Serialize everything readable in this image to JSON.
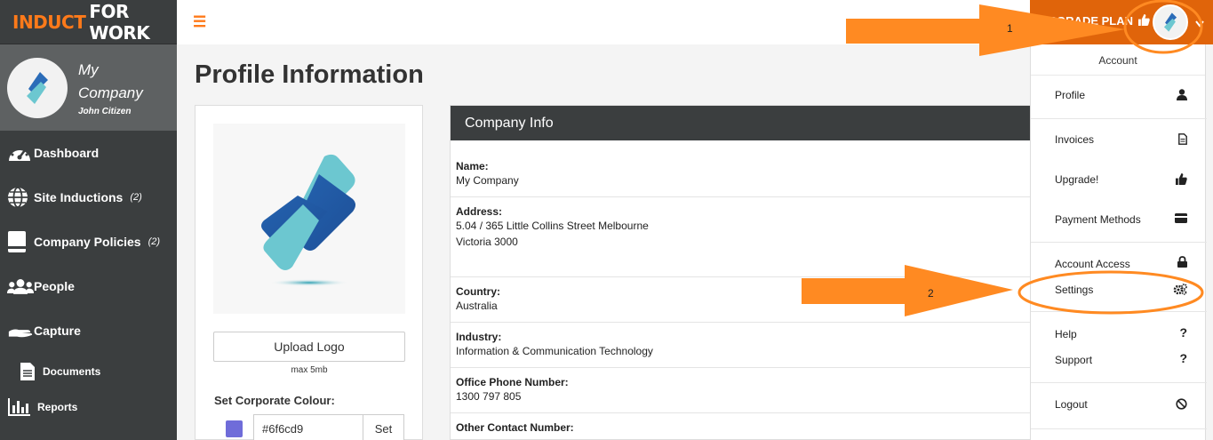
{
  "brand": {
    "part1": "INDUCT",
    "part2": "FOR WORK"
  },
  "company": {
    "name_line1": "My",
    "name_line2": "Company",
    "user": "John Citizen"
  },
  "nav": [
    {
      "label": "Dashboard",
      "icon": "dashboard-gauge-icon",
      "count": ""
    },
    {
      "label": "Site Inductions",
      "icon": "globe-icon",
      "count": "(2)"
    },
    {
      "label": "Company Policies",
      "icon": "book-icon",
      "count": "(2)"
    },
    {
      "label": "People",
      "icon": "people-icon",
      "count": ""
    },
    {
      "label": "Capture",
      "icon": "hand-icon",
      "count": ""
    }
  ],
  "nav_sub": [
    {
      "label": "Documents",
      "icon": "document-icon"
    },
    {
      "label": "Reports",
      "icon": "bar-chart-icon"
    }
  ],
  "topbar": {
    "menu_icon": "hamburger-icon",
    "upgrade_label": "UPGRADE PLAN"
  },
  "page": {
    "title": "Profile Information"
  },
  "logo_card": {
    "upload_label": "Upload Logo",
    "max_label": "max 5mb",
    "colour_label": "Set Corporate Colour:",
    "colour_value": "#6f6cd9",
    "set_label": "Set"
  },
  "info": {
    "header": "Company Info",
    "rows": [
      {
        "label": "Name:",
        "lines": [
          "My Company"
        ]
      },
      {
        "label": "Address:",
        "lines": [
          "5.04 / 365 Little Collins Street Melbourne",
          "Victoria 3000"
        ]
      },
      {
        "label": "Country:",
        "lines": [
          "Australia"
        ]
      },
      {
        "label": "Industry:",
        "lines": [
          "Information & Communication Technology"
        ]
      },
      {
        "label": "Office Phone Number:",
        "lines": [
          "1300 797 805"
        ]
      },
      {
        "label": "Other Contact Number:",
        "lines": []
      }
    ]
  },
  "dropdown": {
    "header": "Account",
    "items": [
      {
        "label": "Profile",
        "icon": "user-icon"
      },
      {
        "label": "Invoices",
        "icon": "file-icon"
      },
      {
        "label": "Upgrade!",
        "icon": "thumbs-up-icon"
      },
      {
        "label": "Payment Methods",
        "icon": "credit-card-icon"
      },
      {
        "label": "Account Access",
        "icon": "lock-icon"
      },
      {
        "label": "Settings",
        "icon": "gears-icon"
      },
      {
        "label": "Help",
        "icon": "question-icon"
      },
      {
        "label": "Support",
        "icon": "question-icon"
      },
      {
        "label": "Logout",
        "icon": "ban-icon"
      }
    ]
  },
  "annotations": {
    "step1": "1",
    "step2": "2",
    "arrow_color": "#ff8a22"
  },
  "colors": {
    "accent": "#e0640a",
    "sidebar": "#3b3e3f",
    "corporate": "#6f6cd9"
  }
}
